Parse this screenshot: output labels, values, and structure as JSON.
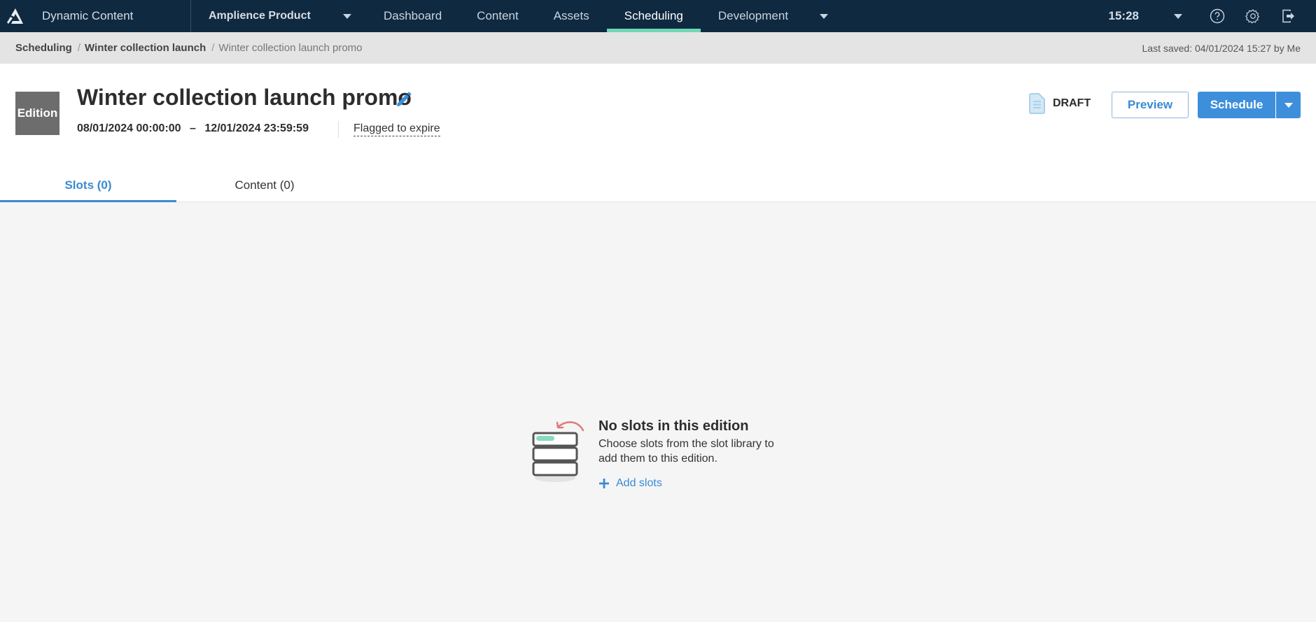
{
  "topnav": {
    "app_name": "Dynamic Content",
    "hub_name": "Amplience Product",
    "tabs": [
      {
        "label": "Dashboard",
        "active": false
      },
      {
        "label": "Content",
        "active": false
      },
      {
        "label": "Assets",
        "active": false
      },
      {
        "label": "Scheduling",
        "active": true
      },
      {
        "label": "Development",
        "active": false
      }
    ],
    "clock": "15:28",
    "icons": [
      "help-icon",
      "settings-icon",
      "logout-icon"
    ],
    "active_accent": "#6fd8b4"
  },
  "breadcrumb": {
    "items": [
      {
        "label": "Scheduling"
      },
      {
        "label": "Winter collection launch"
      },
      {
        "label": "Winter collection launch promo"
      }
    ],
    "separator": "/",
    "last_saved": "Last saved: 04/01/2024 15:27 by Me"
  },
  "header": {
    "badge": "Edition",
    "title": "Winter collection launch promo",
    "start": "08/01/2024 00:00:00",
    "range_sep": "–",
    "end": "12/01/2024 23:59:59",
    "flag": "Flagged to expire",
    "status": "DRAFT",
    "preview_label": "Preview",
    "schedule_label": "Schedule",
    "accent": "#3d8fdc"
  },
  "tabs": [
    {
      "label": "Slots (0)",
      "active": true
    },
    {
      "label": "Content (0)",
      "active": false
    }
  ],
  "empty_state": {
    "title": "No slots in this edition",
    "description": "Choose slots from the slot library to add them to this edition.",
    "action": "Add slots"
  }
}
